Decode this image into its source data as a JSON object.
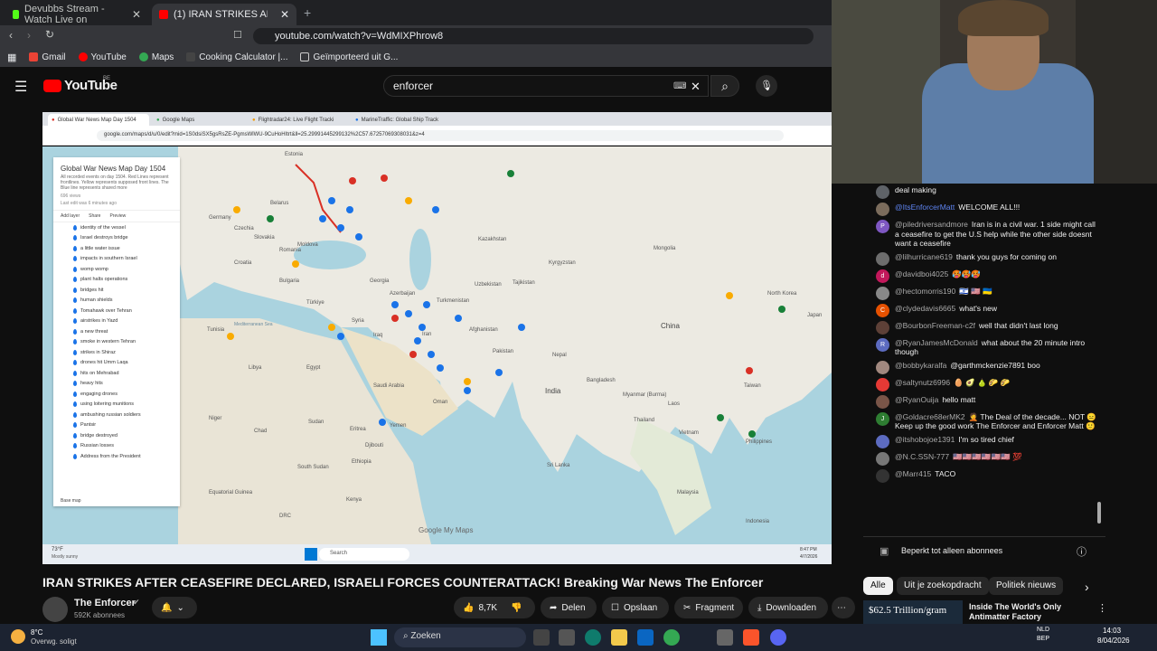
{
  "browser": {
    "tabs": [
      {
        "label": "Devubbs Stream - Watch Live on",
        "active": false
      },
      {
        "label": "(1) IRAN STRIKES AFTER CEAS",
        "active": true
      }
    ],
    "url": "youtube.com/watch?v=WdMIXPhrow8",
    "bookmarks": [
      "Gmail",
      "YouTube",
      "Maps",
      "Cooking Calculator |...",
      "Geïmporteerd uit G..."
    ]
  },
  "youtube": {
    "logo": "YouTube",
    "region": "BE",
    "search_value": "enforcer"
  },
  "video": {
    "inner_tabs": [
      "Global War News Map Day 1504",
      "Google Maps",
      "Flightradar24: Live Flight Tracki",
      "MarineTraffic: Global Ship Track"
    ],
    "inner_url": "google.com/maps/d/u/0/edit?mid=1S0dsiSX5gsRsZE-PgmsWlWU-9CuHoHItrt&ll=25.29991445299132%2C57.67257069308031&z=4",
    "panel": {
      "title": "Global War News Map Day 1504",
      "description": "All recorded events on day 1504. Red Lines represent frontlines. Yellow represents supposed front lines. The Blue line represents shared more",
      "views": "696 views",
      "last_edit": "Last edit was 6 minutes ago",
      "actions": [
        "Add layer",
        "Share",
        "Preview"
      ],
      "items": [
        "identity of the vessel",
        "Israel destroys bridge",
        "a little water issue",
        "impacts in southern Israel",
        "womp womp",
        "plant halts operations",
        "bridges hit",
        "human shields",
        "Tomahawk over Tehran",
        "airstrikes in Yazd",
        "a new threat",
        "smoke in western Tehran",
        "strikes in Shiraz",
        "drones hit Umm Laqa",
        "hits on Mehrabad",
        "heavy hits",
        "engaging drones",
        "using loitering munitions",
        "ambushing russian soldiers",
        "Pantsir",
        "bridge destroyed",
        "Russian losses",
        "Address from the President"
      ],
      "base_map": "Base map"
    },
    "map_labels": [
      "Estonia",
      "Belarus",
      "Germany",
      "Czechia",
      "Slovakia",
      "Moldova",
      "Croatia",
      "Romania",
      "Bulgaria",
      "Türkiye",
      "Georgia",
      "Azerbaijan",
      "Turkmenistan",
      "Uzbekistan",
      "Kazakhstan",
      "Kyrgyzstan",
      "Tajikistan",
      "Mongolia",
      "North Korea",
      "Japan",
      "China",
      "Tunisia",
      "Syria",
      "Iraq",
      "Iran",
      "Afghanistan",
      "Pakistan",
      "Nepal",
      "India",
      "Bangladesh",
      "Myanmar (Burma)",
      "Laos",
      "Taiwan",
      "Libya",
      "Egypt",
      "Saudi Arabia",
      "Oman",
      "Yemen",
      "Niger",
      "Chad",
      "Sudan",
      "Eritrea",
      "Djibouti",
      "Ethiopia",
      "South Sudan",
      "Kenya",
      "Equatorial Guinea",
      "DRC",
      "Thailand",
      "Vietnam",
      "Philippines",
      "Sri Lanka",
      "Malaysia",
      "Indonesia",
      "Mediterranean Sea"
    ],
    "google_mark": "Google My Maps",
    "weather": "73°F",
    "weather_desc": "Mostly sunny",
    "search_label": "Search",
    "clock": "8:47 PM",
    "date": "4/7/2026"
  },
  "title": "IRAN STRIKES AFTER CEASEFIRE DECLARED, ISRAELI FORCES COUNTERATTACK! Breaking War News The Enforcer",
  "channel": {
    "name": "The Enforcer",
    "subs": "592K abonnees"
  },
  "actions": {
    "likes": "8,7K",
    "share": "Delen",
    "save": "Opslaan",
    "clip": "Fragment",
    "download": "Downloaden"
  },
  "chat": {
    "messages": [
      {
        "author": "",
        "text": "deal making",
        "avatar_color": "#5f6368"
      },
      {
        "author": "@ItsEnforcerMatt",
        "text": "WELCOME ALL!!!",
        "avatar_color": "#7b6c5c",
        "highlight": true
      },
      {
        "author": "@piledriversandmore",
        "text": "Iran is in a civil war. 1 side might call a ceasefire to get the U.S help while the other side doesnt want a ceasefire",
        "avatar_color": "#7e57c2",
        "initial": "P"
      },
      {
        "author": "@lilhurricane619",
        "text": "thank you guys for coming on",
        "avatar_color": "#6d6d6d"
      },
      {
        "author": "@davidboi4025",
        "text": "🥵🥵🥵",
        "avatar_color": "#c2185b",
        "initial": "d"
      },
      {
        "author": "@hectomorris190",
        "text": "🇮🇱 🇺🇸 🇺🇦",
        "avatar_color": "#888"
      },
      {
        "author": "@clydedavis6665",
        "text": "what's new",
        "avatar_color": "#e65100",
        "initial": "C"
      },
      {
        "author": "@BourbonFreeman-c2f",
        "text": "well that didn't last long",
        "avatar_color": "#5d4037"
      },
      {
        "author": "@RyanJamesMcDonald",
        "text": "what about the 20 minute intro though",
        "avatar_color": "#5c6bc0",
        "initial": "R"
      },
      {
        "author": "@bobbykaralfa",
        "text": "@garthmckenzie7891 boo",
        "avatar_color": "#a1887f"
      },
      {
        "author": "@saltynutz6996",
        "text": "🥚 🥑 🍐 🌮 🌮",
        "avatar_color": "#e53935"
      },
      {
        "author": "@RyanOuija",
        "text": "hello matt",
        "avatar_color": "#795548"
      },
      {
        "author": "@Goldacre68erMK2",
        "text": "🤦 The Deal of the decade... NOT 😑 Keep up the good work The Enforcer and Enforcer Matt 🙂",
        "avatar_color": "#2e7d32",
        "initial": "J"
      },
      {
        "author": "@itshobojoe1391",
        "text": "I'm so tired chief",
        "avatar_color": "#5c6bc0"
      },
      {
        "author": "@N.C.SSN-777",
        "text": "🇺🇸🇺🇸🇺🇸🇺🇸🇺🇸🇺🇸 💯",
        "avatar_color": "#777"
      },
      {
        "author": "@Marr415",
        "text": "TACO",
        "avatar_color": "#333"
      }
    ],
    "footer": "Beperkt tot alleen abonnees"
  },
  "chips": [
    "Alle",
    "Uit je zoekopdracht",
    "Politiek nieuws"
  ],
  "recommendation": {
    "thumb_text": "$62.5 Trillion/gram",
    "title": "Inside The World's Only Antimatter Factory"
  },
  "taskbar": {
    "weather_temp": "8°C",
    "weather_desc": "Overwg. soligt",
    "search": "Zoeken",
    "lang1": "NLD",
    "lang2": "BEP",
    "time": "14:03",
    "date": "8/04/2026"
  }
}
